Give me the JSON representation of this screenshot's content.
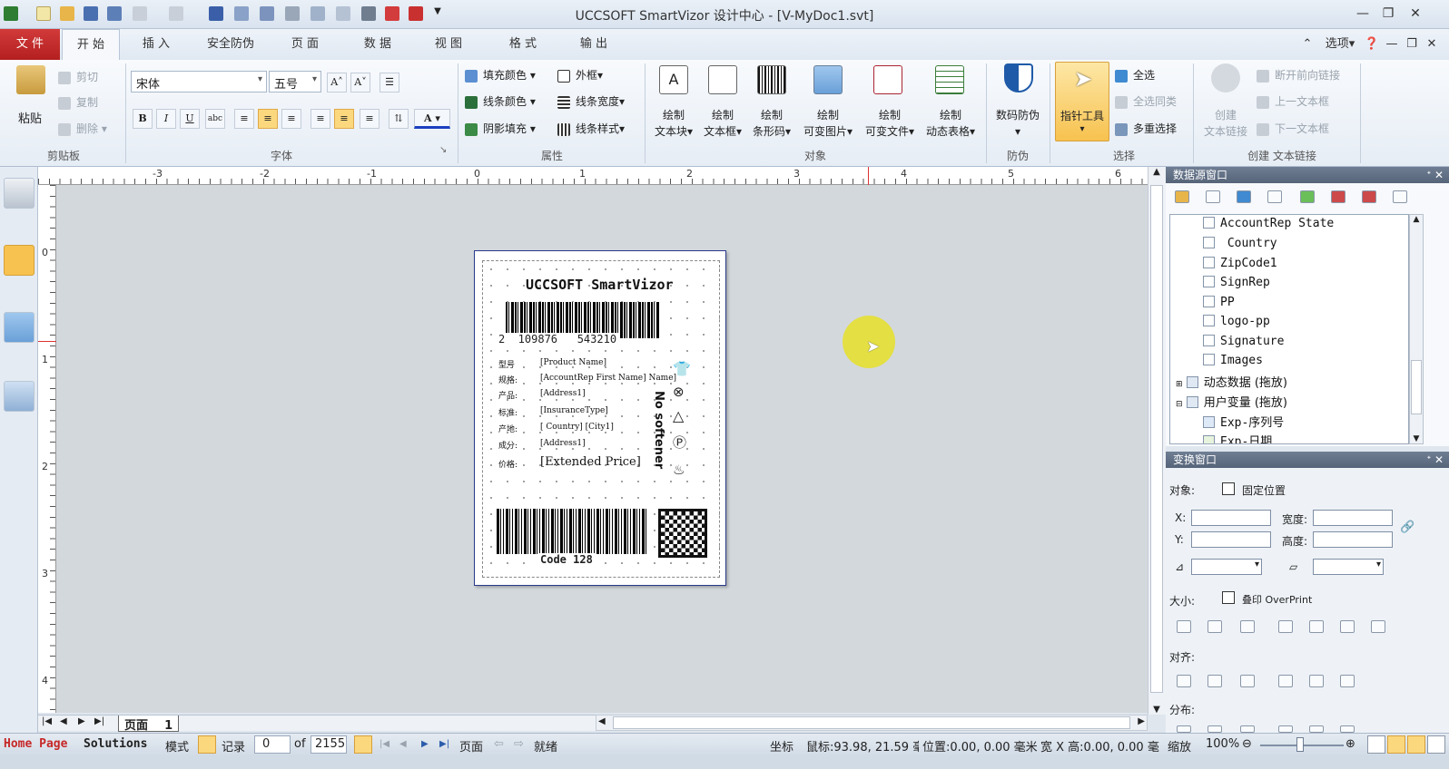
{
  "window": {
    "title": "UCCSOFT SmartVizor 设计中心 - [V-MyDoc1.svt]"
  },
  "tabs": [
    "文 件",
    "开 始",
    "插 入",
    "安全防伪",
    "页 面",
    "数 据",
    "视 图",
    "格 式",
    "输 出"
  ],
  "topright": {
    "options": "选项"
  },
  "clipboard": {
    "paste": "粘贴",
    "cut": "剪切",
    "copy": "复制",
    "delete": "删除",
    "label": "剪贴板"
  },
  "font": {
    "family": "宋体",
    "size": "五号",
    "label": "字体"
  },
  "attrs": {
    "fill": "填充颜色",
    "line_color": "线条颜色",
    "shadow": "阴影填充",
    "frame": "外框",
    "line_width": "线条宽度",
    "line_style": "线条样式",
    "label": "属性"
  },
  "objects": {
    "textblock": [
      "绘制",
      "文本块"
    ],
    "textbox": [
      "绘制",
      "文本框"
    ],
    "barcode": [
      "绘制",
      "条形码"
    ],
    "image": [
      "绘制",
      "可变图片"
    ],
    "file": [
      "绘制",
      "可变文件"
    ],
    "table": [
      "绘制",
      "动态表格"
    ],
    "label": "对象"
  },
  "security": {
    "btn": "数码防伪",
    "label": "防伪"
  },
  "select": {
    "pointer": "指针工具",
    "all": "全选",
    "same": "全选同类",
    "multi": "多重选择",
    "label": "选择"
  },
  "textlink": {
    "create": [
      "创建",
      "文本链接"
    ],
    "break": "断开前向链接",
    "prev": "上一文本框",
    "next": "下一文本框",
    "label": "创建 文本链接"
  },
  "ruler": {
    "h": [
      "-3",
      "-2",
      "-1",
      "0",
      "1",
      "2",
      "3",
      "4",
      "5",
      "6"
    ],
    "v": [
      "0",
      "1",
      "2",
      "3",
      "4"
    ]
  },
  "labeldoc": {
    "title": "UCCSOFT SmartVizor",
    "barcode1": "2  109876   543210",
    "fields": [
      {
        "k": "型号",
        "v": "[Product Name]"
      },
      {
        "k": "规格:",
        "v": "[AccountRep First Name] Name]"
      },
      {
        "k": "产品:",
        "v": "[Address1]"
      },
      {
        "k": "标准:",
        "v": "[InsuranceType]"
      },
      {
        "k": "产地:",
        "v": "[ Country] [City1]"
      },
      {
        "k": "成分:",
        "v": "[Address1]"
      },
      {
        "k": "价格:",
        "v": "[Extended Price]"
      }
    ],
    "vertical": "No softener",
    "barcode2": "Code 128"
  },
  "pagebar": {
    "tab": "页面",
    "num": "1"
  },
  "ds": {
    "header": "数据源窗口",
    "items": [
      "AccountRep State",
      " Country",
      "ZipCode1",
      "SignRep",
      "PP",
      "logo-pp",
      "Signature",
      "Images",
      "动态数据 (拖放)",
      "用户变量 (拖放)",
      "Exp-序列号",
      "Exp-日期"
    ]
  },
  "xf": {
    "header": "变换窗口",
    "object": "对象:",
    "fixed": "固定位置",
    "x": "X:",
    "width": "宽度:",
    "y": "Y:",
    "height": "高度:",
    "size": "大小:",
    "overprint": "叠印 OverPrint",
    "align": "对齐:",
    "distribute": "分布:"
  },
  "status": {
    "homepage": "Home Page",
    "solutions": "Solutions",
    "mode": "模式",
    "record": "记录",
    "rec_val": "0",
    "of": "of",
    "total": "2155",
    "page": "页面",
    "ready": "就绪",
    "coord": "坐标",
    "mouse": "鼠标:93.98, 21.59 毫",
    "pos": "位置:0.00, 0.00 毫米",
    "wh": "宽 X 高:0.00, 0.00 毫",
    "zoom": "缩放",
    "zoom_val": "100%"
  }
}
